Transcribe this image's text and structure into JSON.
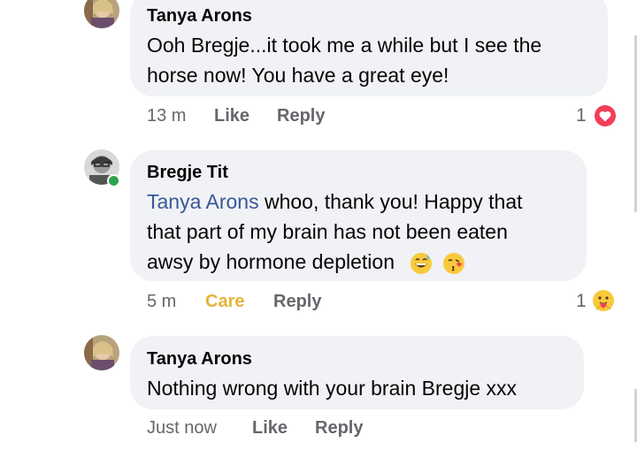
{
  "comments": [
    {
      "author": "Tanya Arons",
      "lines": [
        "Ooh Bregje...it took me a while but I see the",
        "horse now!  You have a great eye!"
      ],
      "time": "13 m",
      "reaction_label": "Like",
      "reply_label": "Reply",
      "reaction_count": "1",
      "reaction_icon": "heart-icon"
    },
    {
      "author": "Bregje Tit",
      "mention": "Tanya Arons",
      "line1_rest": " whoo, thank you! Happy that",
      "line2": "that part of my brain has not been eaten",
      "line3": "awsy by hormone depletion",
      "line3_emojis": [
        "grinning-sweat-emoji",
        "kissing-heart-emoji"
      ],
      "time": "5 m",
      "reaction_label": "Care",
      "reply_label": "Reply",
      "reaction_count": "1",
      "reaction_icon": "care-emoji-icon",
      "online": true
    },
    {
      "author": "Tanya Arons",
      "lines": [
        "Nothing wrong with your brain Bregje xxx"
      ],
      "time": "Just now",
      "reaction_label": "Like",
      "reply_label": "Reply"
    }
  ],
  "colors": {
    "bubble": "#f0f2f5",
    "mention": "#385898",
    "care": "#e7b23a",
    "heart": "#f33e58",
    "online": "#31a24c",
    "meta": "#65676b"
  }
}
